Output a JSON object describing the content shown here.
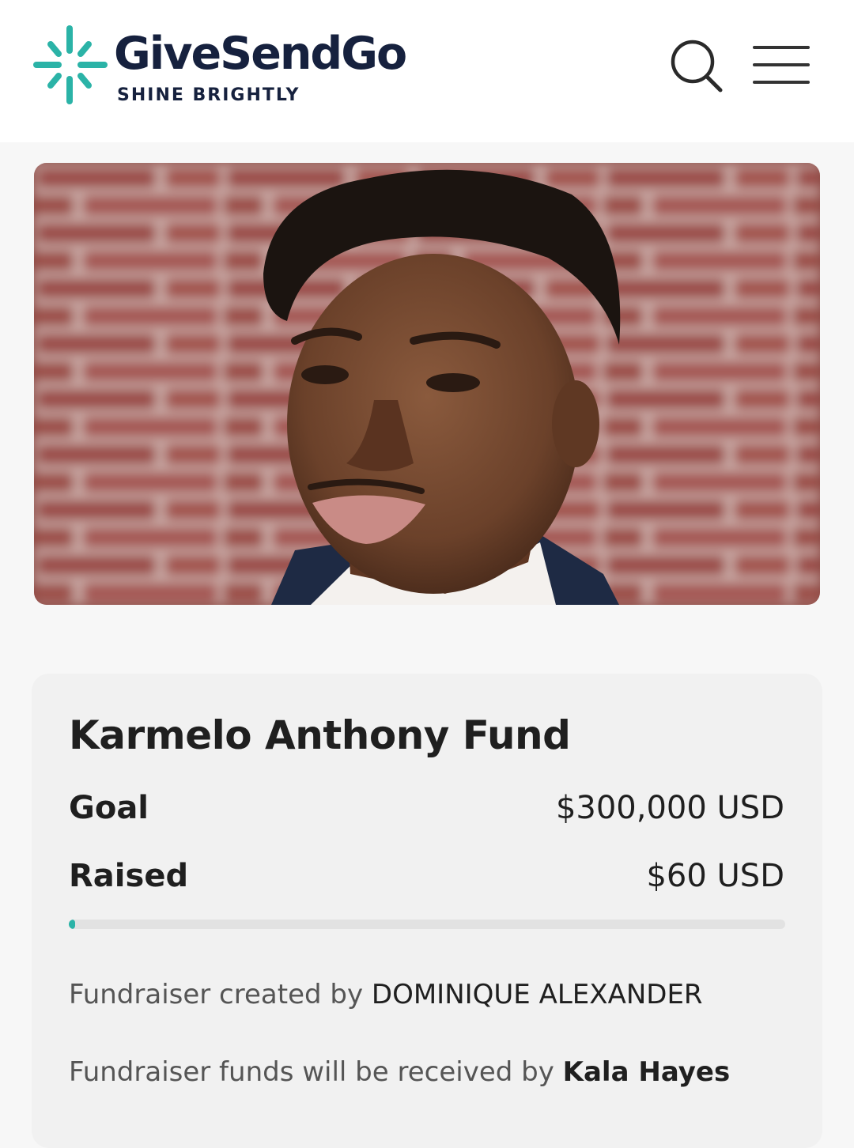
{
  "header": {
    "brand_name": "GiveSendGo",
    "tagline": "SHINE BRIGHTLY",
    "accent_color": "#2bb3a7",
    "brand_color": "#16213e",
    "icons": [
      "sparkle-logo-icon",
      "search-icon",
      "hamburger-menu-icon"
    ]
  },
  "campaign": {
    "title": "Karmelo Anthony Fund",
    "goal_label": "Goal",
    "goal_value": "$300,000 USD",
    "raised_label": "Raised",
    "raised_value": "$60 USD",
    "progress_fraction": 0.0002,
    "created_by_prefix": "Fundraiser created by",
    "created_by_name": "DOMINIQUE ALEXANDER",
    "received_by_prefix": "Fundraiser funds will be received by",
    "received_by_name": "Kala Hayes"
  }
}
